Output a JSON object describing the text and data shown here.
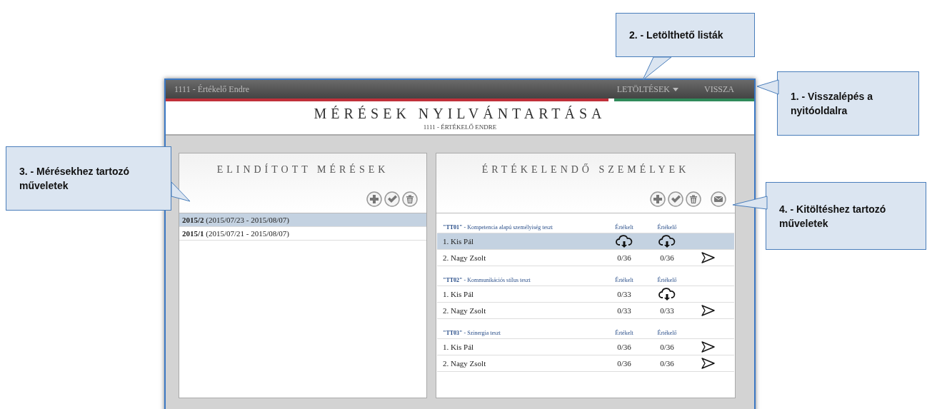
{
  "top_bar": {
    "user": "1111 - Értékelő Endre",
    "menu": [
      {
        "label": "LETÖLTÉSEK",
        "dropdown": true
      },
      {
        "label": "VISSZA",
        "dropdown": false
      }
    ]
  },
  "header": {
    "title": "MÉRÉSEK NYILVÁNTARTÁSA",
    "subtitle": "1111 - ÉRTÉKELŐ ENDRE"
  },
  "left_panel": {
    "title": "ELINDÍTOTT MÉRÉSEK",
    "items": [
      {
        "label": "**2015/2** (2015/07/23 - 2015/08/07)",
        "selected": true
      },
      {
        "label": "**2015/1** (2015/07/21 - 2015/08/07)",
        "selected": false
      }
    ]
  },
  "right_panel": {
    "title": "ÉRTÉKELENDŐ SZEMÉLYEK",
    "groups": [
      {
        "title": "**\"TT01\"** - Kompetencia alapú személyiség teszt",
        "columns": [
          "Értékelt",
          "Értékelő"
        ],
        "rows": [
          {
            "name": "1. Kis Pál",
            "selected": true,
            "cells": [
              {
                "kind": "download"
              },
              {
                "kind": "download"
              }
            ],
            "send": false
          },
          {
            "name": "2. Nagy Zsolt",
            "selected": false,
            "cells": [
              {
                "kind": "text",
                "text": "0/36"
              },
              {
                "kind": "text",
                "text": "0/36"
              }
            ],
            "send": true
          }
        ]
      },
      {
        "title": "**\"TT02\"** - Kommunikációs stílus teszt",
        "columns": [
          "Értékelt",
          "Értékelő"
        ],
        "rows": [
          {
            "name": "1. Kis Pál",
            "selected": false,
            "cells": [
              {
                "kind": "text",
                "text": "0/33"
              },
              {
                "kind": "download"
              }
            ],
            "send": false
          },
          {
            "name": "2. Nagy Zsolt",
            "selected": false,
            "cells": [
              {
                "kind": "text",
                "text": "0/33"
              },
              {
                "kind": "text",
                "text": "0/33"
              }
            ],
            "send": true
          }
        ]
      },
      {
        "title": "**\"TT03\"** - Szinergia teszt",
        "columns": [
          "Értékelt",
          "Értékelő"
        ],
        "rows": [
          {
            "name": "1. Kis Pál",
            "selected": false,
            "cells": [
              {
                "kind": "text",
                "text": "0/36"
              },
              {
                "kind": "text",
                "text": "0/36"
              }
            ],
            "send": true
          },
          {
            "name": "2. Nagy Zsolt",
            "selected": false,
            "cells": [
              {
                "kind": "text",
                "text": "0/36"
              },
              {
                "kind": "text",
                "text": "0/36"
              }
            ],
            "send": true
          }
        ]
      }
    ]
  },
  "callouts": [
    {
      "text": "1. - Visszalépés a nyitóoldalra"
    },
    {
      "text": "2. - Letölthető listák"
    },
    {
      "text": "3. - Mérésekhez tartozó műveletek"
    },
    {
      "text": "4. - Kitöltéshez tartozó műveletek"
    }
  ]
}
